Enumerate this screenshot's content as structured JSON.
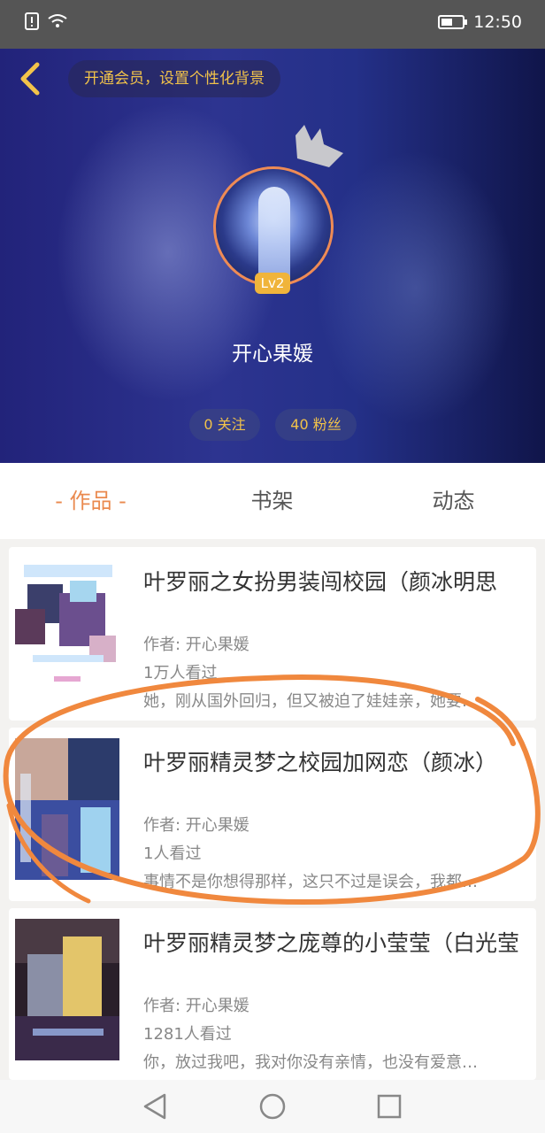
{
  "status_bar": {
    "time": "12:50",
    "battery_level": 0.55,
    "icons": [
      "alert-icon",
      "wifi-icon",
      "battery-icon"
    ]
  },
  "header": {
    "back_icon": "chevron-left-icon",
    "vip_banner": "开通会员，设置个性化背景",
    "level": "Lv2",
    "username": "开心果媛",
    "following": "0 关注",
    "followers": "40 粉丝"
  },
  "tabs": [
    {
      "label": "- 作品 -",
      "active": true
    },
    {
      "label": "书架",
      "active": false
    },
    {
      "label": "动态",
      "active": false
    }
  ],
  "works": [
    {
      "title": "叶罗丽之女扮男装闯校园（颜冰明思",
      "author": "作者: 开心果媛",
      "views": "1万人看过",
      "description": "她，刚从国外回归，但又被迫了娃娃亲，她要…"
    },
    {
      "title": "叶罗丽精灵梦之校园加网恋（颜冰）",
      "author": "作者: 开心果媛",
      "views": "1人看过",
      "description": "事情不是你想得那样，这只不过是误会，我都…"
    },
    {
      "title": "叶罗丽精灵梦之庞尊的小莹莹（白光莹",
      "author": "作者: 开心果媛",
      "views": "1281人看过",
      "description": "你，放过我吧，我对你没有亲情，也没有爱意…"
    }
  ],
  "nav_bar": {
    "icons": [
      "back-triangle-icon",
      "home-circle-icon",
      "recents-square-icon"
    ]
  },
  "colors": {
    "accent": "#ea8a4f",
    "gold": "#f1c24a",
    "annotation": "#f0883e"
  }
}
